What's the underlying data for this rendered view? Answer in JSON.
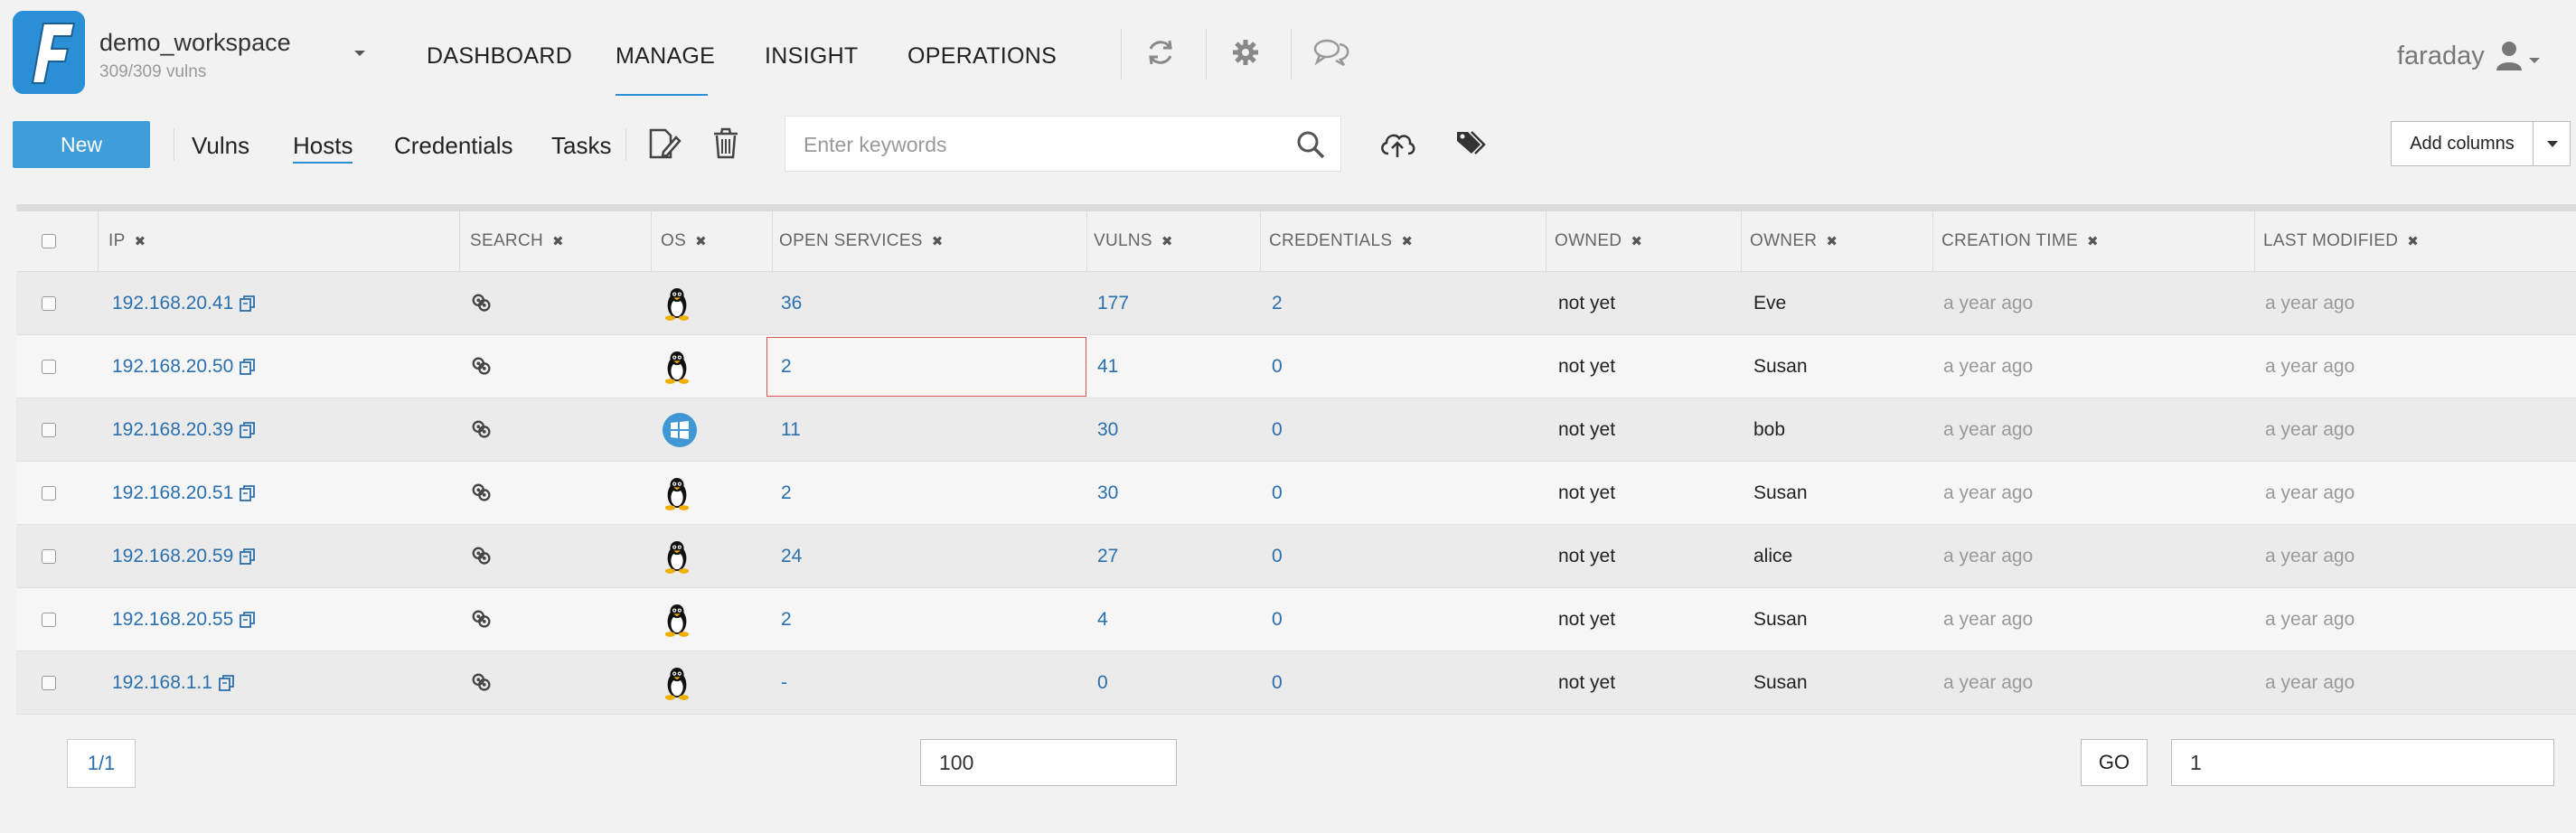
{
  "header": {
    "workspace_name": "demo_workspace",
    "workspace_vulns": "309/309 vulns",
    "nav": [
      "DASHBOARD",
      "MANAGE",
      "INSIGHT",
      "OPERATIONS"
    ],
    "active_nav": "MANAGE",
    "user": "faraday"
  },
  "toolbar": {
    "new_label": "New",
    "links": [
      "Vulns",
      "Hosts",
      "Credentials",
      "Tasks"
    ],
    "active_link": "Hosts",
    "search_placeholder": "Enter keywords",
    "add_columns_label": "Add columns"
  },
  "table": {
    "columns": [
      "IP",
      "SEARCH",
      "OS",
      "OPEN SERVICES",
      "VULNS",
      "CREDENTIALS",
      "OWNED",
      "OWNER",
      "CREATION TIME",
      "LAST MODIFIED"
    ],
    "rows": [
      {
        "ip": "192.168.20.41",
        "os": "linux",
        "services": "36",
        "vulns": "177",
        "credentials": "2",
        "owned": "not yet",
        "owner": "Eve",
        "created": "a year ago",
        "modified": "a year ago"
      },
      {
        "ip": "192.168.20.50",
        "os": "linux",
        "services": "2",
        "vulns": "41",
        "credentials": "0",
        "owned": "not yet",
        "owner": "Susan",
        "created": "a year ago",
        "modified": "a year ago"
      },
      {
        "ip": "192.168.20.39",
        "os": "windows",
        "services": "11",
        "vulns": "30",
        "credentials": "0",
        "owned": "not yet",
        "owner": "bob",
        "created": "a year ago",
        "modified": "a year ago"
      },
      {
        "ip": "192.168.20.51",
        "os": "linux",
        "services": "2",
        "vulns": "30",
        "credentials": "0",
        "owned": "not yet",
        "owner": "Susan",
        "created": "a year ago",
        "modified": "a year ago"
      },
      {
        "ip": "192.168.20.59",
        "os": "linux",
        "services": "24",
        "vulns": "27",
        "credentials": "0",
        "owned": "not yet",
        "owner": "alice",
        "created": "a year ago",
        "modified": "a year ago"
      },
      {
        "ip": "192.168.20.55",
        "os": "linux",
        "services": "2",
        "vulns": "4",
        "credentials": "0",
        "owned": "not yet",
        "owner": "Susan",
        "created": "a year ago",
        "modified": "a year ago"
      },
      {
        "ip": "192.168.1.1",
        "os": "linux",
        "services": "-",
        "vulns": "0",
        "credentials": "0",
        "owned": "not yet",
        "owner": "Susan",
        "created": "a year ago",
        "modified": "a year ago"
      }
    ]
  },
  "pagination": {
    "page_label": "1/1",
    "page_size": "100",
    "go_label": "GO",
    "go_page": "1"
  },
  "colors": {
    "accent": "#2b8fd6",
    "new_button": "#3f9ed9",
    "link": "#2a6fae",
    "highlight_border": "#d9534f"
  }
}
